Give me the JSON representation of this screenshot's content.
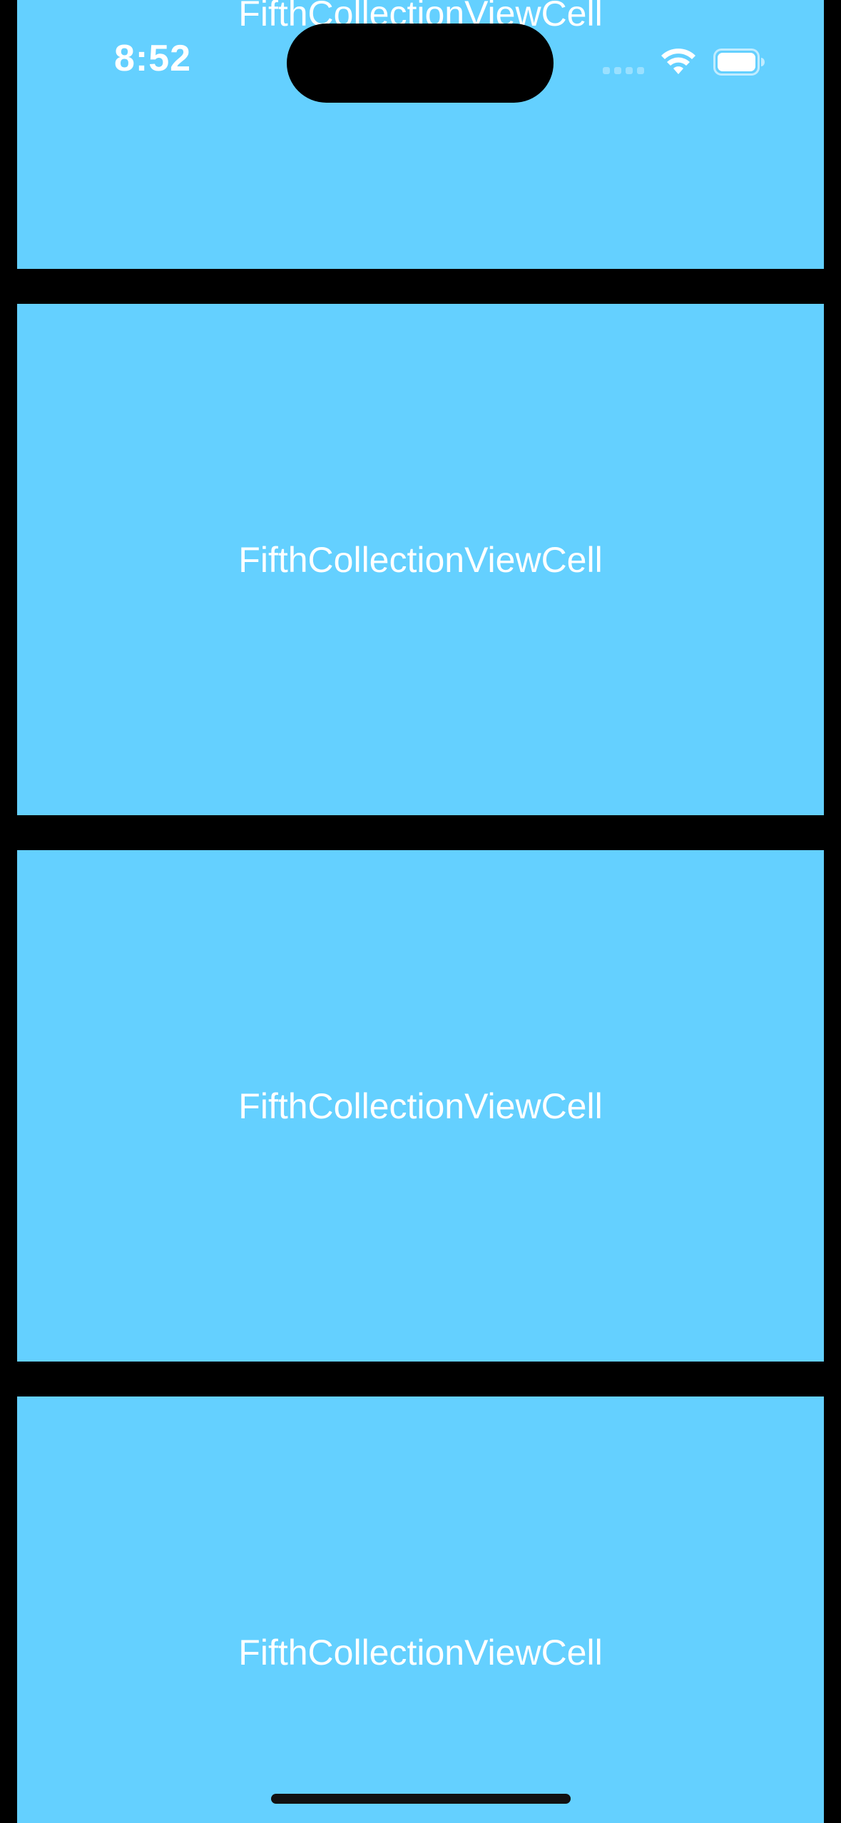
{
  "status_bar": {
    "time": "8:52",
    "signal_icon": "cellular-signal-icon",
    "wifi_icon": "wifi-icon",
    "battery_icon": "battery-icon"
  },
  "collection": {
    "cells": [
      {
        "label": "FifthCollectionViewCell"
      },
      {
        "label": "FifthCollectionViewCell"
      },
      {
        "label": "FifthCollectionViewCell"
      },
      {
        "label": "FifthCollectionViewCell"
      }
    ]
  },
  "colors": {
    "background": "#000000",
    "cell": "#64D0FF",
    "text": "#FFFFFF"
  }
}
